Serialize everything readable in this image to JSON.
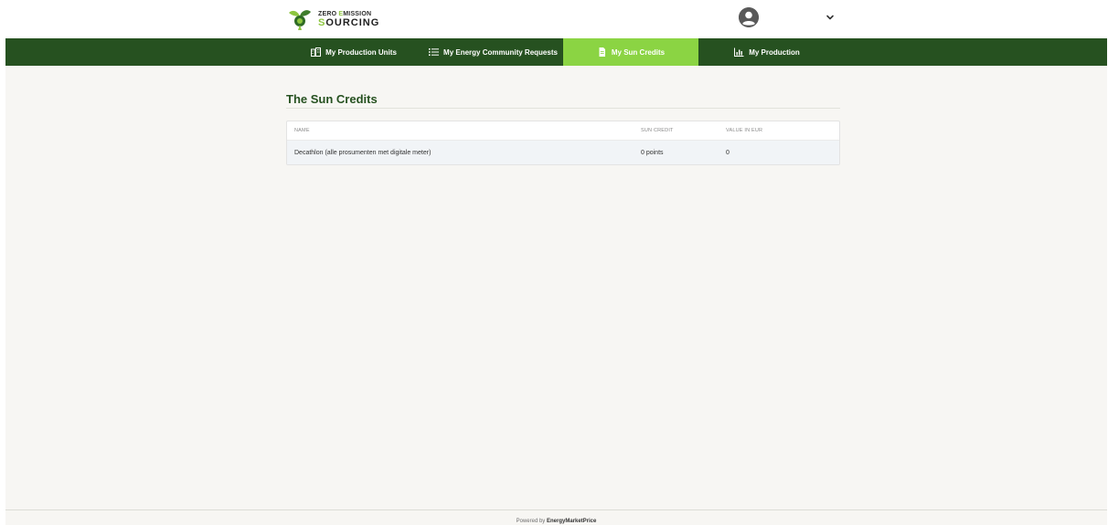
{
  "header": {
    "logo": {
      "line1_part1": "ZERO ",
      "line1_accent": "E",
      "line1_part2": "MISSION",
      "line2_accent": "S",
      "line2_part": "OURCING"
    },
    "user_icon": "user-circle-icon",
    "menu_icon": "chevron-down-icon"
  },
  "nav": {
    "items": [
      {
        "label": "My Production Units",
        "icon": "building-icon",
        "active": false
      },
      {
        "label": "My Energy Community Requests",
        "icon": "list-icon",
        "active": false
      },
      {
        "label": "My Sun Credits",
        "icon": "document-icon",
        "active": true
      },
      {
        "label": "My Production",
        "icon": "bar-chart-icon",
        "active": false
      }
    ]
  },
  "page": {
    "title": "The Sun Credits"
  },
  "table": {
    "columns": [
      "NAME",
      "SUN CREDIT",
      "VALUE IN EUR"
    ],
    "rows": [
      [
        "Decathlon (alle prosumenten met digitale meter)",
        "0 points",
        "0"
      ]
    ]
  },
  "footer": {
    "prefix": "Powered by ",
    "brand": "EnergyMarketPrice"
  },
  "colors": {
    "nav_bg": "#265120",
    "nav_active": "#8bd443",
    "title": "#265120",
    "page_bg": "#f7f6f3",
    "row_bg": "#f1f4f7"
  }
}
